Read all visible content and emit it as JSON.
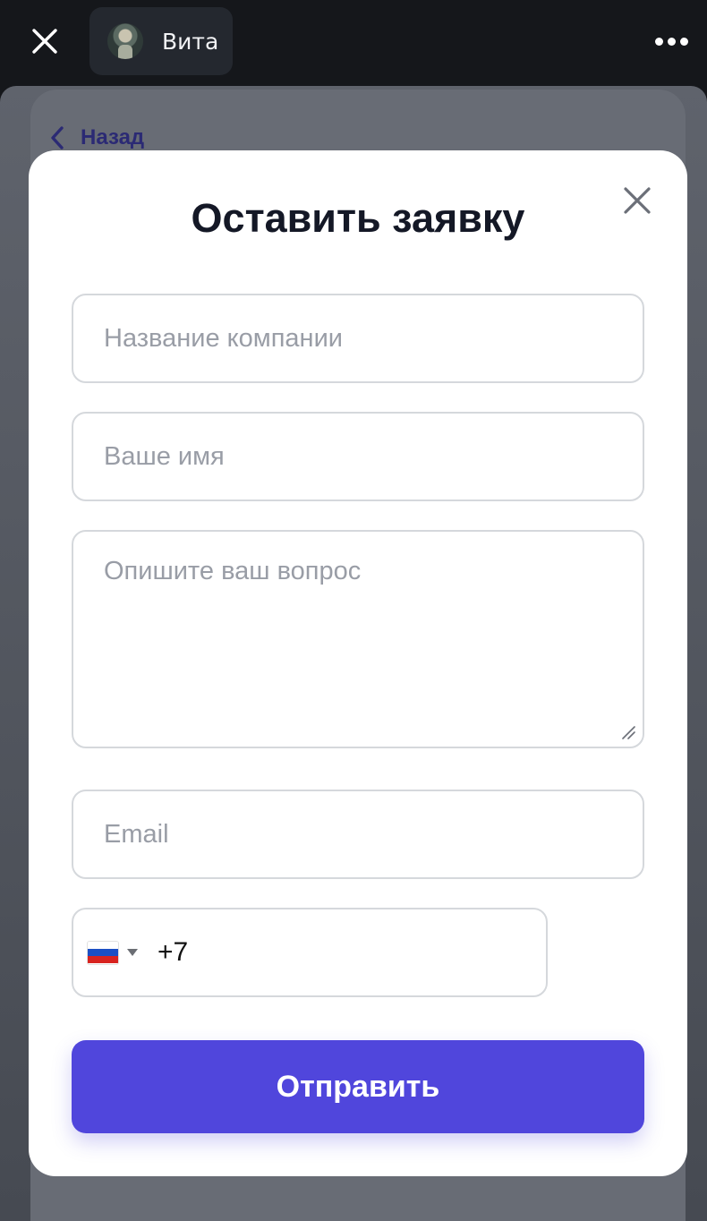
{
  "topbar": {
    "profile_name": "Вита"
  },
  "page": {
    "back_label": "Назад"
  },
  "modal": {
    "title": "Оставить заявку",
    "fields": {
      "company_placeholder": "Название компании",
      "name_placeholder": "Ваше имя",
      "question_placeholder": "Опишите ваш вопрос",
      "email_placeholder": "Email"
    },
    "phone": {
      "country": "RU",
      "code": "+7"
    },
    "submit_label": "Отправить"
  },
  "colors": {
    "accent": "#5046dc",
    "title": "#141826",
    "placeholder": "#999da6",
    "border": "#d5d8dc",
    "topbar": "#15171b"
  },
  "icons": {
    "top_close": "close-icon",
    "more": "more-dots-icon",
    "back": "chevron-left-icon",
    "modal_close": "close-icon",
    "country": "flag-ru-icon",
    "dropdown": "caret-down-icon"
  }
}
